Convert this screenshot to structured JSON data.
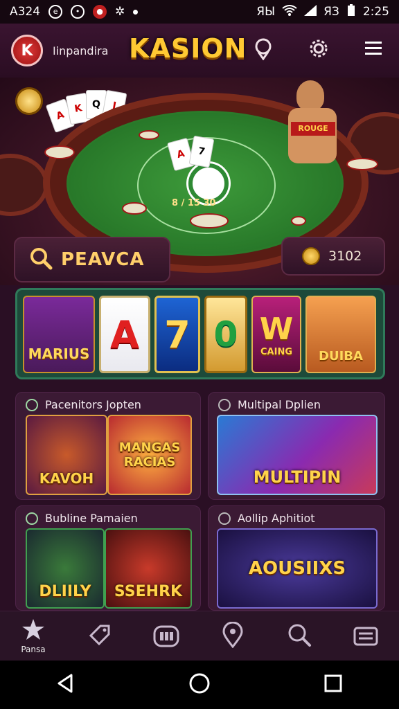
{
  "status_bar": {
    "carrier": "A324",
    "signal_label": "ЯЫ",
    "battery_label": "ЯЗ",
    "time": "2:25"
  },
  "app_bar": {
    "logo_text": "K",
    "subtitle": "Iinpandira",
    "brand": "KASION"
  },
  "search": {
    "label": "PEAVCA"
  },
  "balance": {
    "value": "3102"
  },
  "hero_texts": {
    "dealer_shirt": "ROUGE",
    "felt_line_1": "8 / 15  30",
    "card_1": "A",
    "card_2": "7"
  },
  "reels": [
    {
      "label": "MARIUS"
    },
    {
      "label": "A"
    },
    {
      "label": "7"
    },
    {
      "label": "0"
    },
    {
      "label": "W"
    },
    {
      "label": "DUIBA"
    }
  ],
  "reel_sub": {
    "wild": "CAING"
  },
  "sections": [
    {
      "title": "Pacenitors Jopten",
      "games": [
        "KAVOH",
        "MANGAS RACIAS"
      ]
    },
    {
      "title": "Multipal Dplien",
      "games": [
        "MULTIPIN"
      ]
    },
    {
      "title": "Bubline Pamaien",
      "games": [
        "DLIILY",
        "SSEHRK"
      ]
    },
    {
      "title": "Aollip Aphitiot",
      "games": [
        "AOUSIIXS"
      ]
    }
  ],
  "bottom_nav": {
    "home_label": "Pansa"
  },
  "colors": {
    "accent_gold": "#ffc933",
    "background": "#2a0f24",
    "felt_green": "#2f8a32"
  }
}
